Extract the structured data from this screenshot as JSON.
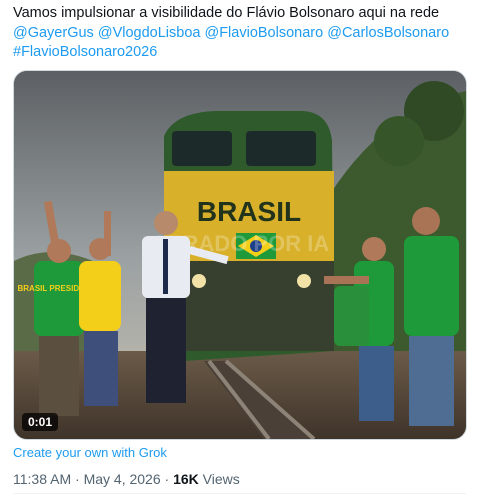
{
  "tweet": {
    "text_line1": "Vamos impulsionar a visibilidade do Flávio Bolsonaro aqui na rede",
    "mentions": [
      "@GayerGus",
      "@VlogdoLisboa",
      "@FlavioBolsonaro",
      "@CarlosBolsonaro"
    ],
    "hashtag": "#FlavioBolsonaro2026"
  },
  "media": {
    "train_text": "BRASIL",
    "shirt_text": "BRASIL PRESIDENTE",
    "watermark": "GERADO POR IA",
    "video_time": "0:01",
    "colors": {
      "train_green": "#2f5b2c",
      "train_yellow": "#d9b02a",
      "shirt_green": "#1e9a3a",
      "shirt_yellow": "#f4cf1a"
    }
  },
  "grok_link": "Create your own with Grok",
  "meta": {
    "time": "11:38 AM",
    "separator": "·",
    "date": "May 4, 2026",
    "views_count": "16K",
    "views_label": "Views"
  }
}
